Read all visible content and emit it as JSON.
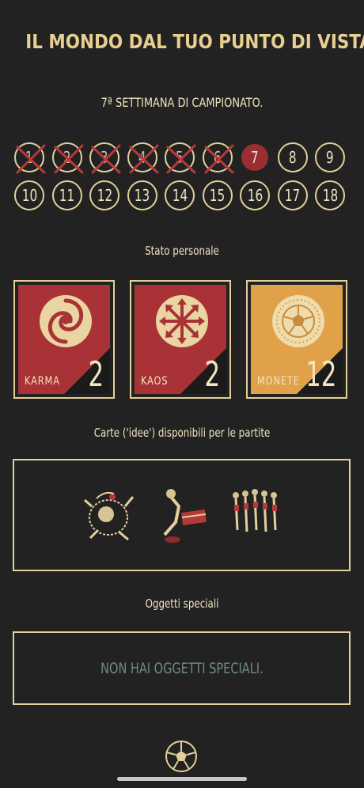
{
  "header": {
    "title": "IL MONDO DAL TUO PUNTO DI VISTA",
    "week_label": "7ª SETTIMANA DI CAMPIONATO."
  },
  "weeks": {
    "numbers": [
      "1",
      "2",
      "3",
      "4",
      "5",
      "6",
      "7",
      "8",
      "9",
      "10",
      "11",
      "12",
      "13",
      "14",
      "15",
      "16",
      "17",
      "18"
    ],
    "completed": 6,
    "current": 7
  },
  "stats": {
    "section_label": "Stato personale",
    "items": [
      {
        "label": "KARMA",
        "value": "2",
        "color": "#a83236",
        "icon": "spiral-icon"
      },
      {
        "label": "KAOS",
        "value": "2",
        "color": "#a83236",
        "icon": "chaos-arrows-icon"
      },
      {
        "label": "MONETE",
        "value": "12",
        "color": "#e0a148",
        "icon": "coin-ball-icon"
      }
    ]
  },
  "cards": {
    "section_label": "Carte ('idee') disponibili per le partite"
  },
  "objects": {
    "section_label": "Oggetti speciali",
    "empty_message": "NON HAI OGGETTI SPECIALI."
  },
  "colors": {
    "background": "#222222",
    "accent_gold": "#e3cf9a",
    "accent_red": "#9b2e32",
    "muted_teal": "#6f8a84"
  }
}
